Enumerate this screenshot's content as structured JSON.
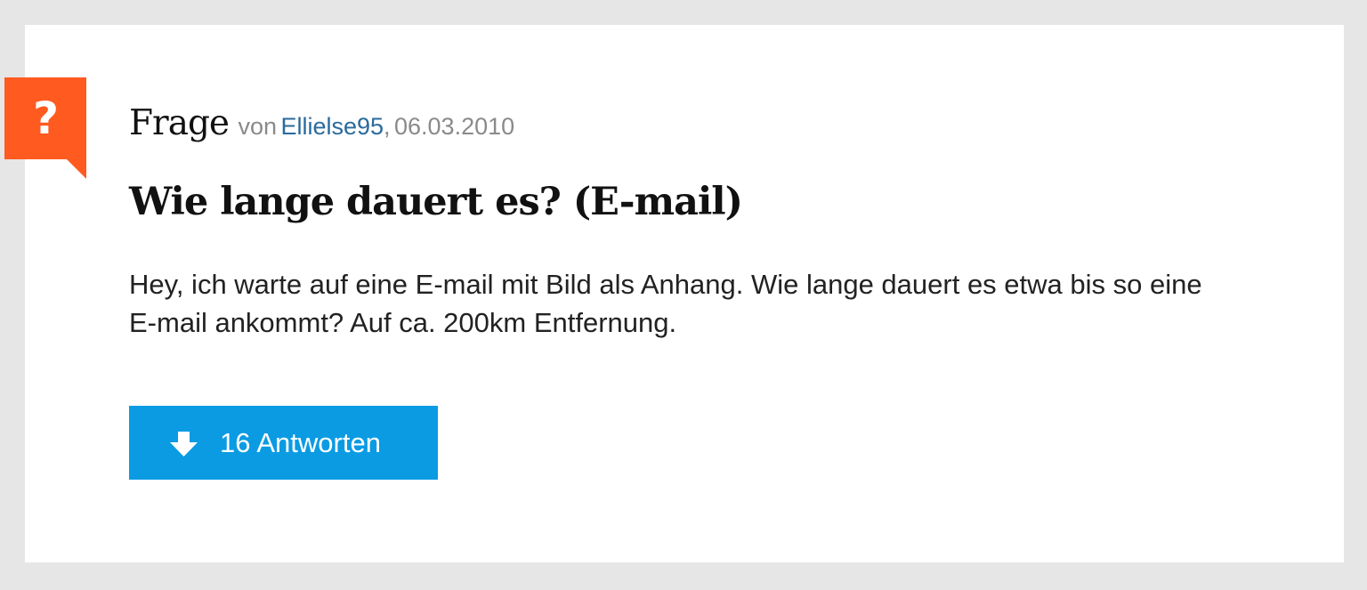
{
  "question": {
    "badge_icon": "question-mark-icon",
    "badge_symbol": "?",
    "badge_color": "#ff5a1f",
    "kind_label": "Frage",
    "von_label": "von",
    "author": "Ellielse95",
    "date_separator": ",",
    "date": "06.03.2010",
    "title": "Wie lange dauert es? (E-mail)",
    "body": "Hey, ich warte auf eine E-mail mit Bild als Anhang. Wie lange dauert es etwa bis so eine E-mail ankommt? Auf ca. 200km Entfernung."
  },
  "answers_button": {
    "icon": "arrow-down-icon",
    "label": "16 Antworten",
    "color": "#0a9be3"
  }
}
